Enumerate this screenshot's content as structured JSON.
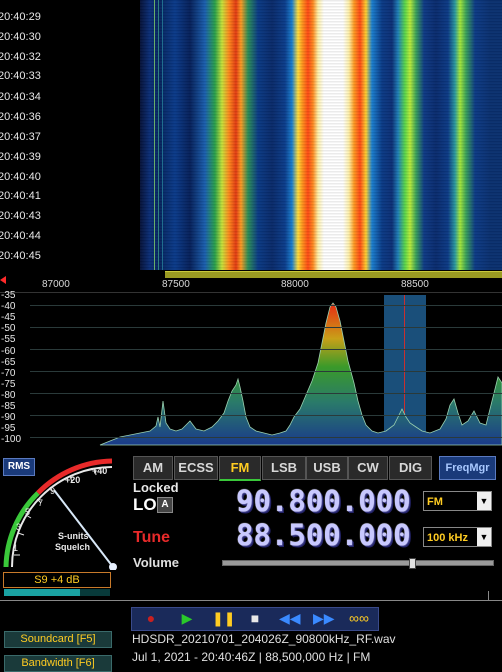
{
  "waterfall": {
    "times": [
      "20:40:29",
      "20:40:30",
      "20:40:32",
      "20:40:33",
      "20:40:34",
      "20:40:36",
      "20:40:37",
      "20:40:39",
      "20:40:40",
      "20:40:41",
      "20:40:43",
      "20:40:44",
      "20:40:45"
    ]
  },
  "freq_scale": {
    "ticks": [
      "87000",
      "87500",
      "88000",
      "88500"
    ]
  },
  "spectrum": {
    "db_labels": [
      "-35",
      "-40",
      "-45",
      "-50",
      "-55",
      "-60",
      "-65",
      "-70",
      "-75",
      "-80",
      "-85",
      "-90",
      "-95",
      "-100"
    ]
  },
  "smeter": {
    "rms_label": "RMS",
    "scale_labels": [
      "1",
      "3",
      "5",
      "7",
      "9",
      "+20",
      "+40"
    ],
    "caption_line1": "S-units",
    "caption_line2": "Squelch",
    "reading": "S9 +4 dB",
    "level_fraction": 0.72
  },
  "modes": [
    {
      "label": "AM",
      "active": false
    },
    {
      "label": "ECSS",
      "active": false
    },
    {
      "label": "FM",
      "active": true
    },
    {
      "label": "LSB",
      "active": false
    },
    {
      "label": "USB",
      "active": false
    },
    {
      "label": "CW",
      "active": false
    },
    {
      "label": "DIG",
      "active": false
    }
  ],
  "freqmgr_label": "FreqMgr",
  "lo": {
    "locked_label": "Locked",
    "label": "LO",
    "a_label": "A",
    "frequency": "90.800.000",
    "mode_select": "FM"
  },
  "tune": {
    "label": "Tune",
    "frequency": "88.500.000",
    "step_select": "100 kHz"
  },
  "volume": {
    "label": "Volume",
    "level_fraction": 0.7
  },
  "playback": {
    "record_icon": "record-icon",
    "play_icon": "play-icon",
    "pause_icon": "pause-icon",
    "stop_icon": "stop-icon",
    "rewind_icon": "rewind-icon",
    "ffwd_icon": "fast-forward-icon",
    "loop_icon": "loop-icon"
  },
  "file": {
    "name": "HDSDR_20210701_204026Z_90800kHz_RF.wav",
    "info": "Jul 1, 2021 - 20:40:46Z | 88,500,000 Hz | FM"
  },
  "side_buttons": {
    "soundcard": "Soundcard  [F5]",
    "bandwidth": "Bandwidth  [F6]"
  },
  "colors": {
    "accent": "#ffcc22",
    "tune_red": "#e82a2a",
    "button_blue": "#1a3a7a"
  }
}
